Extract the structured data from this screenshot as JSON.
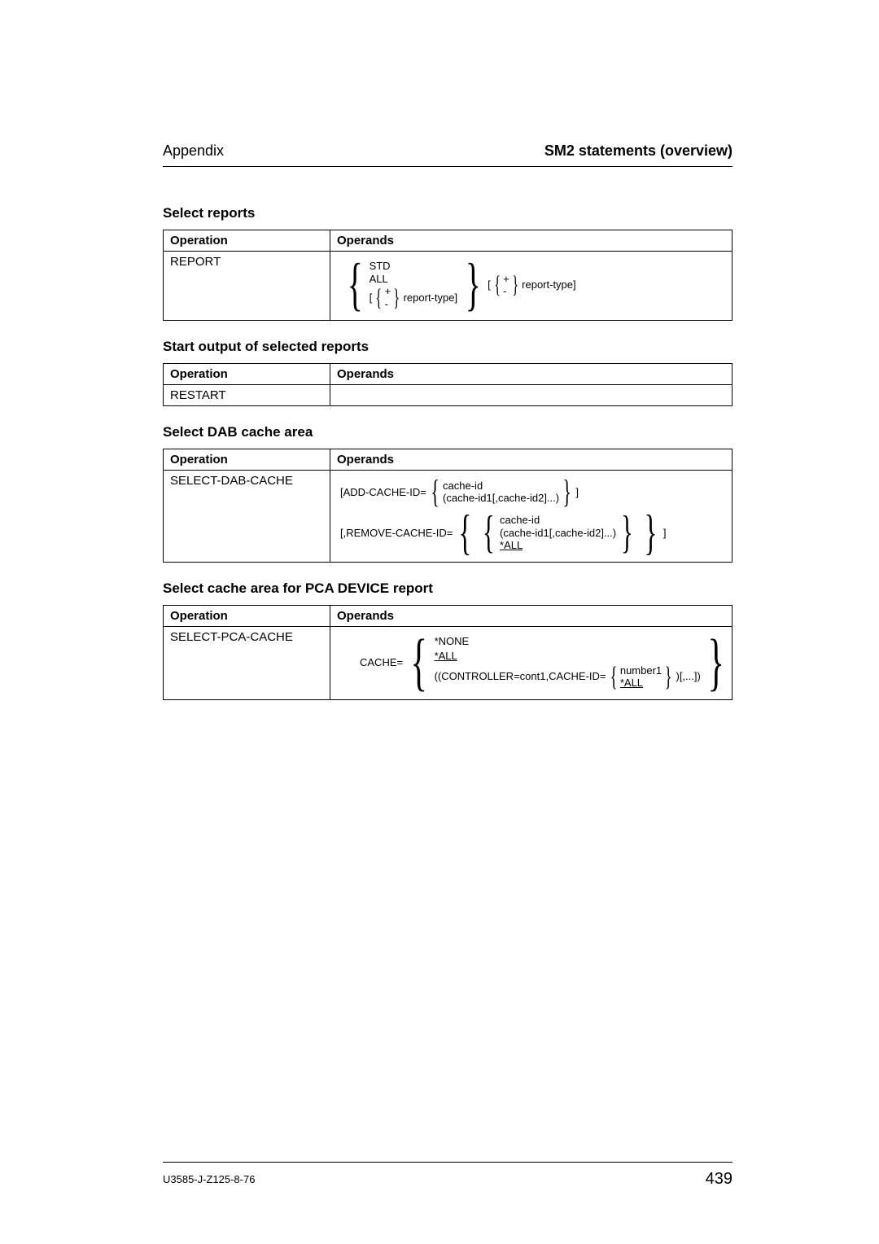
{
  "header": {
    "left": "Appendix",
    "right": "SM2 statements (overview)"
  },
  "columns": {
    "operation": "Operation",
    "operands": "Operands"
  },
  "sections": {
    "report": {
      "title": "Select reports",
      "operation": "REPORT",
      "std": "STD",
      "all": "ALL",
      "plus": "+",
      "minus": "-",
      "rtype": "report-type",
      "lbracket": "[",
      "rbracket": "]"
    },
    "restart": {
      "title": "Start output of selected reports",
      "operation": "RESTART",
      "operands": ""
    },
    "dab": {
      "title": "Select DAB cache area",
      "operation": "SELECT-DAB-CACHE",
      "add_kw": "[ADD-CACHE-ID=",
      "cache_id": "cache-id",
      "cache_list": "(cache-id1[,cache-id2]...)",
      "close1": "]",
      "remove_kw": "[,REMOVE-CACHE-ID=",
      "all": "*ALL",
      "close2": "]"
    },
    "pca": {
      "title": "Select cache area for PCA DEVICE report",
      "operation": "SELECT-PCA-CACHE",
      "cache_kw": "CACHE=",
      "none": "*NONE",
      "all": "*ALL",
      "inner_pre": "((CONTROLLER=cont1,CACHE-ID=",
      "number1": "number1",
      "inner_post": ")[,...])"
    }
  },
  "footer": {
    "doc_id": "U3585-J-Z125-8-76",
    "page": "439"
  }
}
